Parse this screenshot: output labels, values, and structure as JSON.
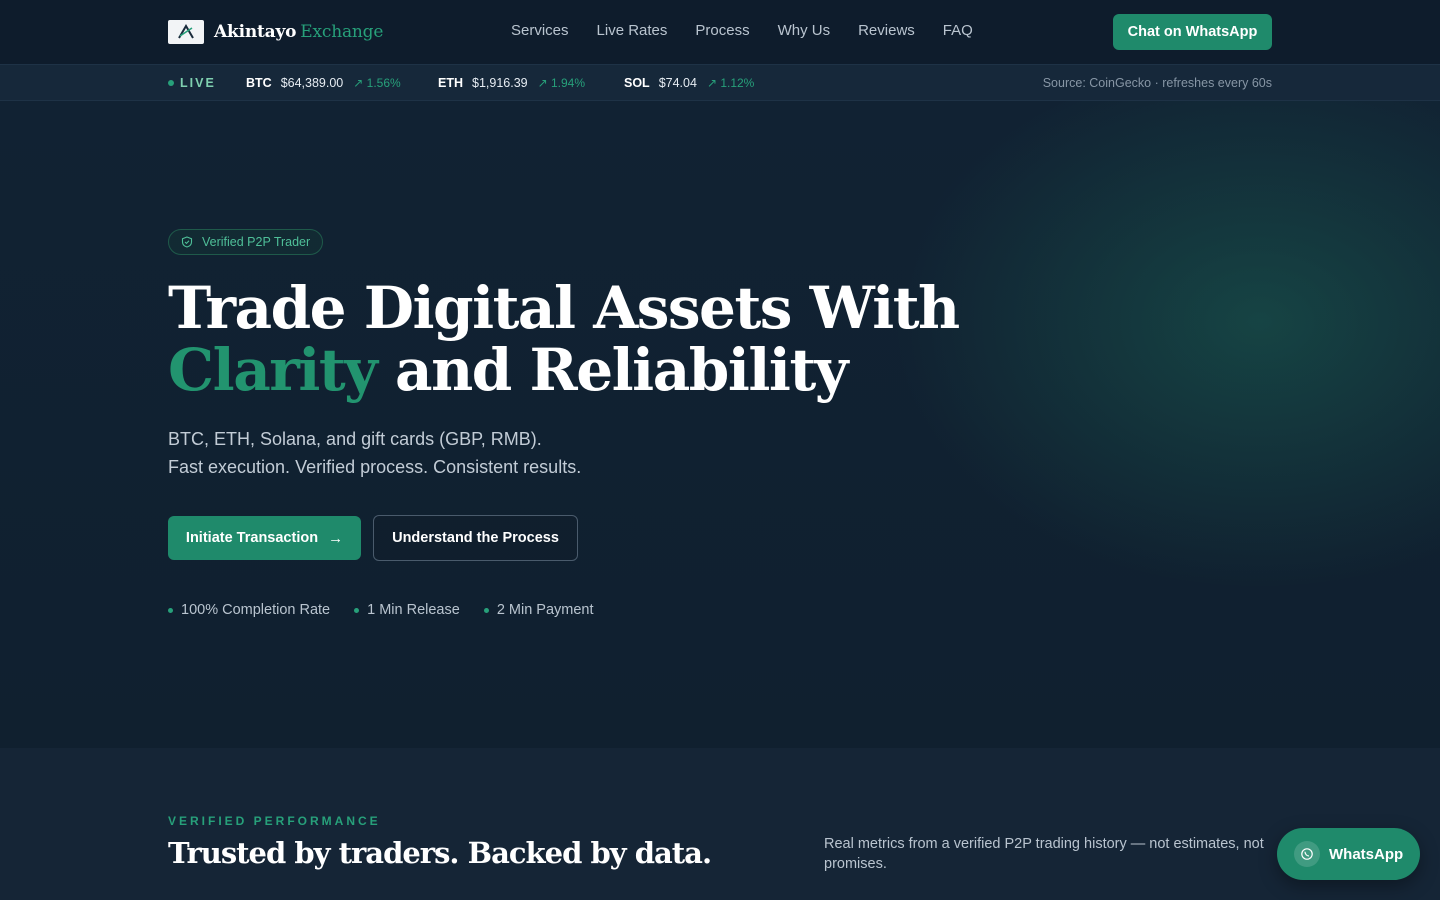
{
  "header": {
    "logo_mark_text": "AX",
    "logo_name": "Akintayo",
    "logo_accent": "Exchange",
    "nav": [
      "Services",
      "Live Rates",
      "Process",
      "Why Us",
      "Reviews",
      "FAQ"
    ],
    "cta_label": "Chat on WhatsApp"
  },
  "ticker": {
    "live_label": "LIVE",
    "coins": [
      {
        "symbol": "BTC",
        "price": "$64,389.00",
        "change": "1.56%"
      },
      {
        "symbol": "ETH",
        "price": "$1,916.39",
        "change": "1.94%"
      },
      {
        "symbol": "SOL",
        "price": "$74.04",
        "change": "1.12%"
      }
    ],
    "source": "Source: CoinGecko · refreshes every 60s"
  },
  "hero": {
    "badge": "Verified P2P Trader",
    "headline_line1": "Trade Digital Assets With",
    "headline_highlight": "Clarity",
    "headline_line2_rest": " and Reliability",
    "sub_line1": "BTC, ETH, Solana, and gift cards (GBP, RMB).",
    "sub_line2": "Fast execution. Verified process. Consistent results.",
    "primary_button": "Initiate Transaction",
    "secondary_button": "Understand the Process",
    "stats": [
      "100% Completion Rate",
      "1 Min Release",
      "2 Min Payment"
    ]
  },
  "performance": {
    "eyebrow": "VERIFIED PERFORMANCE",
    "title": "Trusted by traders. Backed by data.",
    "description": "Real metrics from a verified P2P trading history — not estimates, not promises."
  },
  "floating_whatsapp": {
    "label": "WhatsApp"
  },
  "colors": {
    "accent": "#1f8a6b",
    "accent_text": "#27a07a",
    "background": "#0f1e2e"
  },
  "icons": {
    "badge": "shield-check-icon",
    "ticker_change": "arrow-up-right-icon",
    "primary_button": "arrow-right-icon",
    "floating": "whatsapp-icon"
  }
}
